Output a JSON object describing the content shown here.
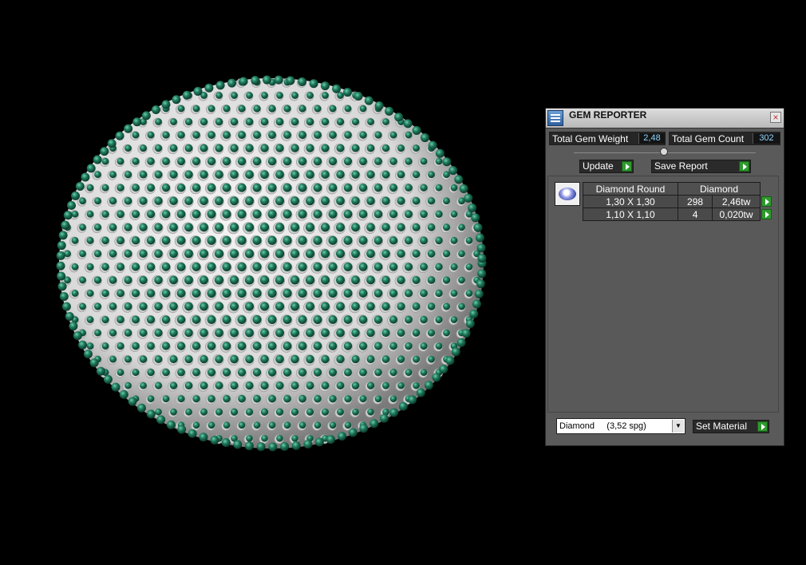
{
  "panel": {
    "title": "GEM REPORTER",
    "icons": {
      "app": "gem-reporter-app-icon",
      "close": "close-icon"
    },
    "stats": {
      "weight_label": "Total Gem Weight",
      "weight_value": "2,48",
      "count_label": "Total Gem Count",
      "count_value": "302"
    },
    "buttons": {
      "update": "Update",
      "save_report": "Save Report",
      "set_material": "Set Material"
    },
    "report": {
      "shape": "Diamond Round",
      "material": "Diamond",
      "rows": [
        {
          "size": "1,30 X 1,30",
          "count": "298",
          "weight": "2,46tw"
        },
        {
          "size": "1,10 X 1,10",
          "count": "4",
          "weight": "0,020tw"
        }
      ]
    },
    "material_select": "Diamond     (3,52 spg)"
  },
  "colors": {
    "gem_green": "#1f7a5e",
    "accent_value": "#8fd5ff",
    "go_green": "#2f9a2f"
  }
}
